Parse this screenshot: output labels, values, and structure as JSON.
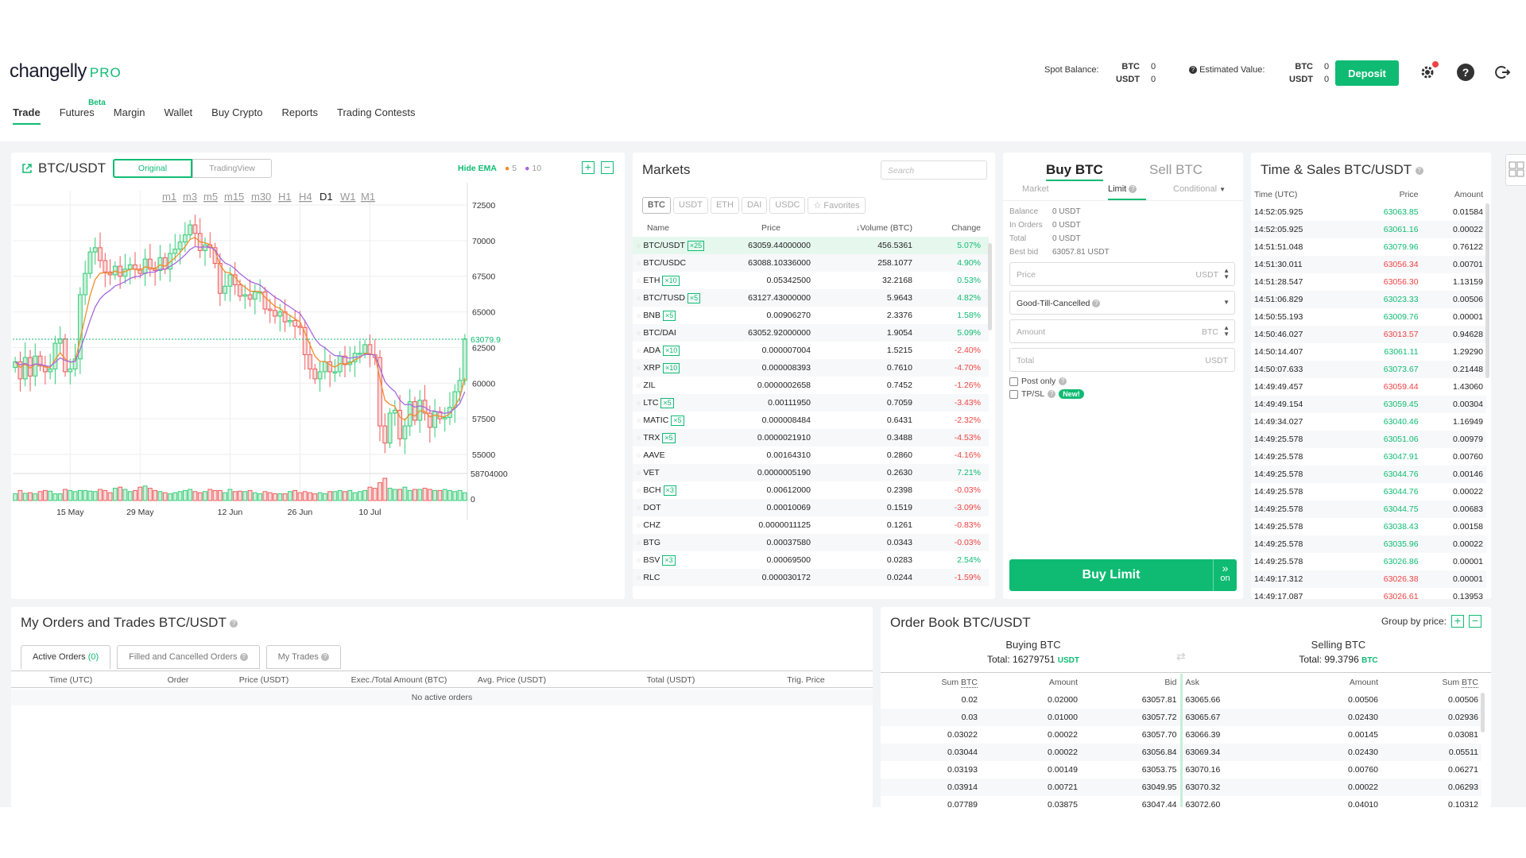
{
  "app": {
    "logo": "changelly",
    "logo_suffix": "PRO"
  },
  "nav": [
    {
      "label": "Trade",
      "active": true
    },
    {
      "label": "Futures",
      "badge": "Beta"
    },
    {
      "label": "Margin"
    },
    {
      "label": "Wallet"
    },
    {
      "label": "Buy Crypto"
    },
    {
      "label": "Reports"
    },
    {
      "label": "Trading Contests"
    }
  ],
  "header": {
    "spot_label": "Spot Balance:",
    "spot": [
      {
        "cur": "BTC",
        "val": "0"
      },
      {
        "cur": "USDT",
        "val": "0"
      }
    ],
    "est_label": "Estimated Value:",
    "est": [
      {
        "cur": "BTC",
        "val": "0"
      },
      {
        "cur": "USDT",
        "val": "0"
      }
    ],
    "deposit": "Deposit",
    "icons": [
      "gear-icon",
      "help-icon",
      "logout-icon"
    ],
    "notif_color": "#ef4343"
  },
  "chart_panel": {
    "pair": "BTC/USDT",
    "tabs": [
      "Original",
      "TradingView"
    ],
    "hide_ema": "Hide EMA",
    "ema5": "5",
    "ema10": "10",
    "ema5_color": "#f08c2c",
    "ema10_color": "#a667e0",
    "timeframes": [
      "m1",
      "m3",
      "m5",
      "m15",
      "m30",
      "H1",
      "H4",
      "D1",
      "W1",
      "M1"
    ],
    "active_tf": "D1",
    "price_ticks": [
      "72500",
      "70000",
      "67500",
      "65000",
      "62500",
      "60000",
      "57500",
      "55000"
    ],
    "current_price": "63079.9",
    "vol_ticks": [
      "58704000",
      "0"
    ],
    "date_ticks": [
      "15 May",
      "29 May",
      "12 Jun",
      "26 Jun",
      "10 Jul"
    ]
  },
  "chart_data": {
    "type": "candlestick",
    "pair": "BTC/USDT",
    "interval": "D1",
    "ylim": [
      54000,
      73500
    ],
    "y_ticks": [
      72500,
      70000,
      67500,
      65000,
      62500,
      60000,
      57500,
      55000
    ],
    "x_ticks": [
      "15 May",
      "29 May",
      "12 Jun",
      "26 Jun",
      "10 Jul"
    ],
    "last_price": 63079.9,
    "volume_max": 58704000,
    "close": [
      61500,
      60300,
      61800,
      60500,
      61900,
      61200,
      60800,
      61000,
      62800,
      63100,
      60800,
      61000,
      61700,
      66200,
      67700,
      69200,
      69500,
      68600,
      67800,
      67600,
      68200,
      67500,
      68000,
      68300,
      68000,
      67700,
      68700,
      68000,
      67900,
      68800,
      68000,
      69100,
      69400,
      69900,
      70400,
      71100,
      70500,
      69300,
      69700,
      69500,
      68400,
      66300,
      66800,
      67600,
      66900,
      66100,
      66200,
      65900,
      66400,
      66400,
      65200,
      65100,
      64700,
      65000,
      64300,
      64400,
      64000,
      63900,
      62000,
      61000,
      60300,
      60800,
      61500,
      60800,
      60800,
      61900,
      61300,
      61500,
      62100,
      62100,
      62700,
      62000,
      61800,
      57000,
      55800,
      57900,
      58100,
      56100,
      57000,
      58700,
      57400,
      58800,
      57900,
      56900,
      58000,
      57500,
      57600,
      58300,
      59400,
      60200,
      63100
    ],
    "volume": [
      0.3,
      0.45,
      0.32,
      0.35,
      0.3,
      0.4,
      0.45,
      0.42,
      0.3,
      0.3,
      0.5,
      0.45,
      0.4,
      0.45,
      0.45,
      0.42,
      0.4,
      0.5,
      0.45,
      0.35,
      0.55,
      0.6,
      0.5,
      0.4,
      0.45,
      0.6,
      0.65,
      0.55,
      0.45,
      0.4,
      0.35,
      0.3,
      0.35,
      0.4,
      0.45,
      0.5,
      0.4,
      0.35,
      0.4,
      0.5,
      0.45,
      0.45,
      0.35,
      0.5,
      0.4,
      0.42,
      0.4,
      0.45,
      0.35,
      0.3,
      0.4,
      0.35,
      0.3,
      0.3,
      0.3,
      0.4,
      0.45,
      0.35,
      0.4,
      0.35,
      0.3,
      0.35,
      0.3,
      0.4,
      0.4,
      0.45,
      0.4,
      0.45,
      0.35,
      0.4,
      0.45,
      0.6,
      0.55,
      0.8,
      1.0,
      0.55,
      0.5,
      0.5,
      0.6,
      0.45,
      0.5,
      0.5,
      0.55,
      0.5,
      0.45,
      0.45,
      0.5,
      0.45,
      0.4,
      0.45,
      0.35
    ]
  },
  "markets": {
    "title": "Markets",
    "search_placeholder": "Search",
    "tabs": [
      "BTC",
      "USDT",
      "ETH",
      "DAI",
      "USDC",
      "☆ Favorites"
    ],
    "headers": [
      "Name",
      "Price",
      "Volume (BTC)",
      "Change"
    ],
    "rows": [
      {
        "name": "BTC/USDT",
        "lev": "×25",
        "price": "63059.44000000",
        "vol": "456.5361",
        "chg": "5.07%",
        "up": true
      },
      {
        "name": "BTC/USDC",
        "lev": "",
        "price": "63088.10336000",
        "vol": "258.1077",
        "chg": "4.90%",
        "up": true
      },
      {
        "name": "ETH",
        "lev": "×10",
        "price": "0.05342500",
        "vol": "32.2168",
        "chg": "0.53%",
        "up": true
      },
      {
        "name": "BTC/TUSD",
        "lev": "×5",
        "price": "63127.43000000",
        "vol": "5.9643",
        "chg": "4.82%",
        "up": true
      },
      {
        "name": "BNB",
        "lev": "×5",
        "price": "0.00906270",
        "vol": "2.3376",
        "chg": "1.58%",
        "up": true
      },
      {
        "name": "BTC/DAI",
        "lev": "",
        "price": "63052.92000000",
        "vol": "1.9054",
        "chg": "5.09%",
        "up": true
      },
      {
        "name": "ADA",
        "lev": "×10",
        "price": "0.000007004",
        "vol": "1.5215",
        "chg": "-2.40%",
        "up": false
      },
      {
        "name": "XRP",
        "lev": "×10",
        "price": "0.000008393",
        "vol": "0.7610",
        "chg": "-4.70%",
        "up": false
      },
      {
        "name": "ZIL",
        "lev": "",
        "price": "0.0000002658",
        "vol": "0.7452",
        "chg": "-1.26%",
        "up": false
      },
      {
        "name": "LTC",
        "lev": "×5",
        "price": "0.00111950",
        "vol": "0.7059",
        "chg": "-3.43%",
        "up": false
      },
      {
        "name": "MATIC",
        "lev": "×5",
        "price": "0.000008484",
        "vol": "0.6431",
        "chg": "-2.32%",
        "up": false
      },
      {
        "name": "TRX",
        "lev": "×5",
        "price": "0.0000021910",
        "vol": "0.3488",
        "chg": "-4.53%",
        "up": false
      },
      {
        "name": "AAVE",
        "lev": "",
        "price": "0.00164310",
        "vol": "0.2860",
        "chg": "-4.16%",
        "up": false
      },
      {
        "name": "VET",
        "lev": "",
        "price": "0.0000005190",
        "vol": "0.2630",
        "chg": "7.21%",
        "up": true
      },
      {
        "name": "BCH",
        "lev": "×3",
        "price": "0.00612000",
        "vol": "0.2398",
        "chg": "-0.03%",
        "up": false
      },
      {
        "name": "DOT",
        "lev": "",
        "price": "0.00010069",
        "vol": "0.1519",
        "chg": "-3.09%",
        "up": false
      },
      {
        "name": "CHZ",
        "lev": "",
        "price": "0.0000011125",
        "vol": "0.1261",
        "chg": "-0.83%",
        "up": false
      },
      {
        "name": "BTG",
        "lev": "",
        "price": "0.00037580",
        "vol": "0.0343",
        "chg": "-0.03%",
        "up": false
      },
      {
        "name": "BSV",
        "lev": "×3",
        "price": "0.00069500",
        "vol": "0.0283",
        "chg": "2.54%",
        "up": true
      },
      {
        "name": "RLC",
        "lev": "",
        "price": "0.000030172",
        "vol": "0.0244",
        "chg": "-1.59%",
        "up": false
      }
    ]
  },
  "order_form": {
    "buy_tab": "Buy BTC",
    "sell_tab": "Sell BTC",
    "types": [
      "Market",
      "Limit",
      "Conditional"
    ],
    "active_type": "Limit",
    "info": [
      {
        "label": "Balance",
        "val": "0 USDT"
      },
      {
        "label": "In Orders",
        "val": "0 USDT"
      },
      {
        "label": "Total",
        "val": "0 USDT"
      },
      {
        "label": "Best bid",
        "val": "63057.81 USDT"
      }
    ],
    "price_ph": "Price",
    "price_cur": "USDT",
    "tif": "Good-Till-Cancelled",
    "amount_ph": "Amount",
    "amount_cur": "BTC",
    "total_ph": "Total",
    "total_cur": "USDT",
    "post_only": "Post only",
    "tpsl": "TP/SL",
    "new_badge": "New!",
    "submit": "Buy Limit",
    "submit_side": "on"
  },
  "time_sales": {
    "title": "Time & Sales BTC/USDT",
    "headers": [
      "Time (UTC)",
      "Price",
      "Amount"
    ],
    "rows": [
      [
        "14:52:05.925",
        "63063.85",
        "0.01584",
        true
      ],
      [
        "14:52:05.925",
        "63061.16",
        "0.00022",
        true
      ],
      [
        "14:51:51.048",
        "63079.96",
        "0.76122",
        true
      ],
      [
        "14:51:30.011",
        "63056.34",
        "0.00701",
        false
      ],
      [
        "14:51:28.547",
        "63056.30",
        "1.13159",
        false
      ],
      [
        "14:51:06.829",
        "63023.33",
        "0.00506",
        true
      ],
      [
        "14:50:55.193",
        "63009.76",
        "0.00001",
        true
      ],
      [
        "14:50:46.027",
        "63013.57",
        "0.94628",
        false
      ],
      [
        "14:50:14.407",
        "63061.11",
        "1.29290",
        true
      ],
      [
        "14:50:07.633",
        "63073.67",
        "0.21448",
        true
      ],
      [
        "14:49:49.457",
        "63059.44",
        "1.43060",
        false
      ],
      [
        "14:49:49.154",
        "63059.45",
        "0.00304",
        true
      ],
      [
        "14:49:34.027",
        "63040.46",
        "1.16949",
        true
      ],
      [
        "14:49:25.578",
        "63051.06",
        "0.00979",
        true
      ],
      [
        "14:49:25.578",
        "63047.91",
        "0.00760",
        true
      ],
      [
        "14:49:25.578",
        "63044.76",
        "0.00146",
        true
      ],
      [
        "14:49:25.578",
        "63044.76",
        "0.00022",
        true
      ],
      [
        "14:49:25.578",
        "63044.75",
        "0.00683",
        true
      ],
      [
        "14:49:25.578",
        "63038.43",
        "0.00158",
        true
      ],
      [
        "14:49:25.578",
        "63035.96",
        "0.00022",
        true
      ],
      [
        "14:49:25.578",
        "63026.86",
        "0.00001",
        true
      ],
      [
        "14:49:17.312",
        "63026.38",
        "0.00001",
        false
      ],
      [
        "14:49:17.087",
        "63026.61",
        "0.13953",
        false
      ]
    ]
  },
  "orders": {
    "title": "My Orders and Trades BTC/USDT",
    "tabs": [
      "Active Orders",
      "Filled and Cancelled Orders",
      "My Trades"
    ],
    "active_count": "(0)",
    "headers": [
      "Time (UTC)",
      "Order",
      "Price (USDT)",
      "Exec./Total Amount (BTC)",
      "Avg. Price (USDT)",
      "Total (USDT)",
      "Trig. Price"
    ],
    "empty": "No active orders"
  },
  "orderbook": {
    "title": "Order Book BTC/USDT",
    "group_label": "Group by price:",
    "buy_title": "Buying BTC",
    "buy_total_label": "Total:",
    "buy_total": "16279751",
    "buy_cur": "USDT",
    "sell_title": "Selling BTC",
    "sell_total_label": "Total:",
    "sell_total": "99.3796",
    "sell_cur": "BTC",
    "headers": [
      "Sum",
      "BTC",
      "Amount",
      "Bid",
      "Ask",
      "Amount",
      "Sum",
      "BTC"
    ],
    "rows": [
      [
        "0.02",
        "0.02000",
        "63057.81",
        "63065.66",
        "0.00506",
        "0.00506"
      ],
      [
        "0.03",
        "0.01000",
        "63057.72",
        "63065.67",
        "0.02430",
        "0.02936"
      ],
      [
        "0.03022",
        "0.00022",
        "63057.70",
        "63066.39",
        "0.00145",
        "0.03081"
      ],
      [
        "0.03044",
        "0.00022",
        "63056.84",
        "63069.34",
        "0.02430",
        "0.05511"
      ],
      [
        "0.03193",
        "0.00149",
        "63053.75",
        "63070.16",
        "0.00760",
        "0.06271"
      ],
      [
        "0.03914",
        "0.00721",
        "63049.95",
        "63070.32",
        "0.00022",
        "0.06293"
      ],
      [
        "0.07789",
        "0.03875",
        "63047.44",
        "63072.60",
        "0.04010",
        "0.10312"
      ]
    ]
  }
}
